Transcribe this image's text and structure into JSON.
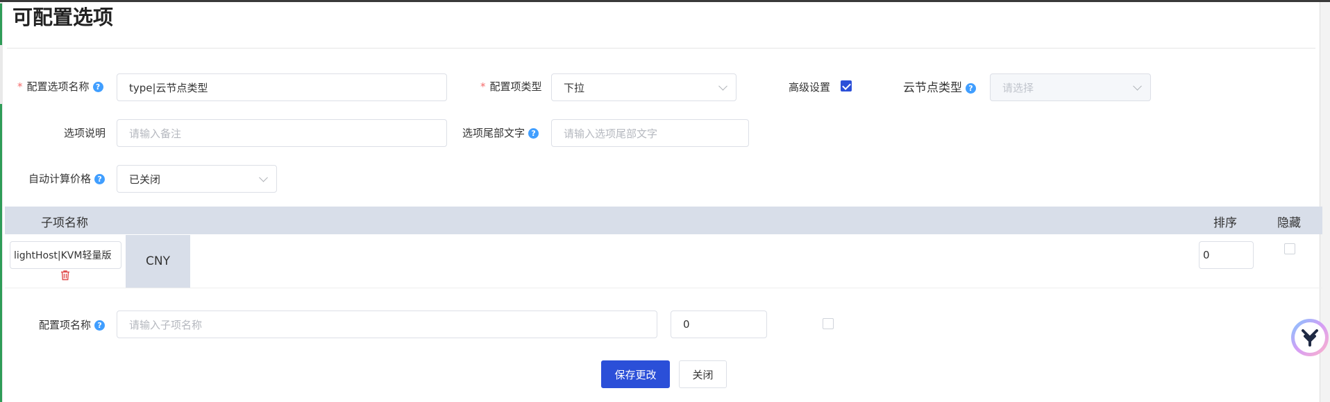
{
  "page": {
    "title": "可配置选项"
  },
  "form": {
    "config_name": {
      "label": "配置选项名称",
      "value": "type|云节点类型"
    },
    "config_type": {
      "label": "配置项类型",
      "value": "下拉"
    },
    "advanced": {
      "label": "高级设置",
      "checked": true
    },
    "node_type": {
      "label": "云节点类型",
      "placeholder": "请选择"
    },
    "desc": {
      "label": "选项说明",
      "placeholder": "请输入备注"
    },
    "suffix": {
      "label": "选项尾部文字",
      "placeholder": "请输入选项尾部文字"
    },
    "auto_price": {
      "label": "自动计算价格",
      "value": "已关闭"
    }
  },
  "table": {
    "headers": {
      "name": "子项名称",
      "sort": "排序",
      "hide": "隐藏"
    },
    "rows": [
      {
        "name": "lightHost|KVM轻量版",
        "currency": "CNY",
        "sort": "0",
        "hidden": false
      }
    ]
  },
  "new_item": {
    "label": "配置项名称",
    "name_placeholder": "请输入子项名称",
    "sort": "0",
    "hidden": false
  },
  "buttons": {
    "save": "保存更改",
    "close": "关闭"
  },
  "colors": {
    "primary": "#2b4fd8",
    "required": "#f56c6c",
    "help": "#409eff",
    "table_header": "#d8dee9"
  }
}
